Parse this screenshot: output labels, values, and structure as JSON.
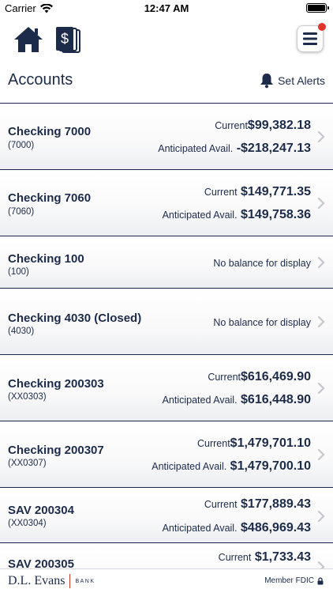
{
  "status_bar": {
    "carrier": "Carrier",
    "time": "12:47 AM",
    "battery_level": 1.0
  },
  "nav": {
    "home_icon": "home-icon",
    "transfer_icon": "dollar-document-icon",
    "menu_icon": "hamburger-menu-icon",
    "notification_color": "#e0342b"
  },
  "header": {
    "title": "Accounts",
    "alerts_label": "Set Alerts",
    "alerts_icon": "bell-icon"
  },
  "accounts": [
    {
      "name": "Checking 7000",
      "number": "(7000)",
      "current_label": "Current",
      "current": "$99,382.18",
      "avail_label": "Anticipated Avail.",
      "avail": "-$218,247.13"
    },
    {
      "name": "Checking 7060",
      "number": "(7060)",
      "current_label": "Current",
      "current": "$149,771.35",
      "avail_label": "Anticipated Avail.",
      "avail": "$149,758.36"
    },
    {
      "name": "Checking 100",
      "number": "(100)",
      "no_balance": "No balance for display"
    },
    {
      "name": "Checking 4030 (Closed)",
      "number": "(4030)",
      "no_balance": "No balance for display"
    },
    {
      "name": "Checking 200303",
      "number": "(XX0303)",
      "current_label": "Current",
      "current": "$616,469.90",
      "avail_label": "Anticipated Avail.",
      "avail": "$616,448.90"
    },
    {
      "name": "Checking 200307",
      "number": "(XX0307)",
      "current_label": "Current",
      "current": "$1,479,701.10",
      "avail_label": "Anticipated Avail.",
      "avail": "$1,479,700.10"
    },
    {
      "name": "SAV 200304",
      "number": "(XX0304)",
      "current_label": "Current",
      "current": "$177,889.43",
      "avail_label": "Anticipated Avail.",
      "avail": "$486,969.43"
    },
    {
      "name": "SAV 200305",
      "current_label": "Current",
      "current": "$1,733.43"
    }
  ],
  "footer": {
    "logo_name": "D.L. Evans",
    "logo_bank": "BANK",
    "fdic": "Member FDIC",
    "lock_icon": "lock-icon"
  },
  "colors": {
    "navy": "#1c2b4a",
    "accent_red": "#e0342b"
  }
}
